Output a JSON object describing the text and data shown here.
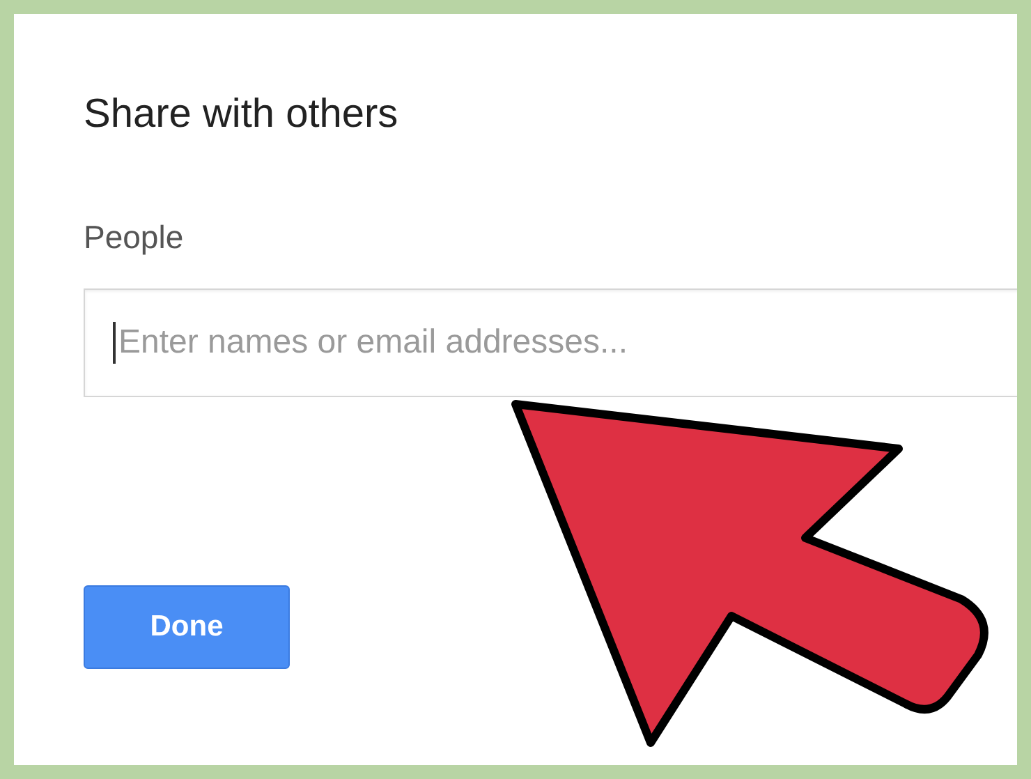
{
  "dialog": {
    "title": "Share with others",
    "people_label": "People",
    "people_field": {
      "placeholder": "Enter names or email addresses..."
    },
    "buttons": [
      {
        "label": "Done",
        "kind": "primary"
      }
    ]
  }
}
